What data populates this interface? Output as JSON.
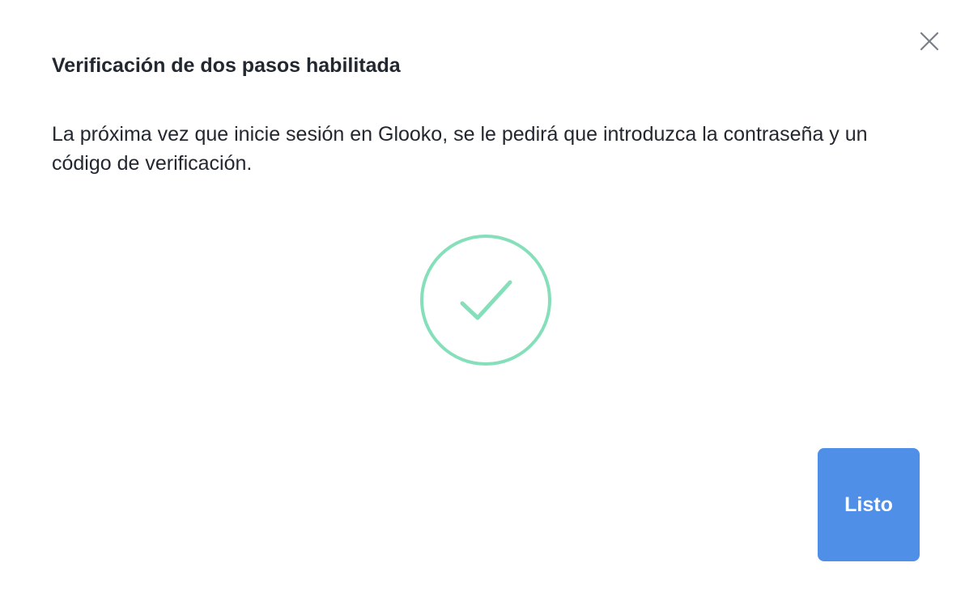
{
  "dialog": {
    "title": "Verificación de dos pasos habilitada",
    "message": "La próxima vez que inicie sesión en Glooko, se le pedirá que introduzca la contraseña y un código de verificación.",
    "done_label": "Listo",
    "icons": {
      "close": "close-icon",
      "success": "check-circle-icon"
    },
    "colors": {
      "accent": "#4f8fe8",
      "success": "#86dfbb",
      "text": "#23272f",
      "close_icon": "#7a7f87"
    }
  }
}
